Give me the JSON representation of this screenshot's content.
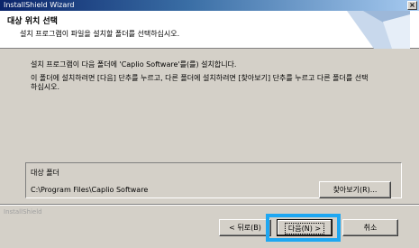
{
  "window": {
    "title": "InstallShield Wizard",
    "close_glyph": "×"
  },
  "header": {
    "title": "대상 위치 선택",
    "subtitle": "설치 프로그램이 파일을 설치할 폴더를 선택하십시오."
  },
  "body": {
    "line1": "설치 프로그램이 다음 폴더에 'Caplio Software'를(를) 설치합니다.",
    "line2": "이 폴더에 설치하려면 [다음] 단추를 누르고, 다른 폴더에 설치하려면 [찾아보기] 단추를 누르고 다른 폴더를 선택하십시오."
  },
  "destination": {
    "label": "대상 폴더",
    "path": "C:\\Program Files\\Caplio Software",
    "browse_label": "찾아보기(R)..."
  },
  "footer": {
    "brand": "InstallShield",
    "back_label": "< 뒤로(B)",
    "next_label": "다음(N) >",
    "cancel_label": "취소"
  },
  "colors": {
    "highlight": "#1ea7f2",
    "titlebar_start": "#0a246a",
    "dialog_bg": "#d4d0c8"
  }
}
